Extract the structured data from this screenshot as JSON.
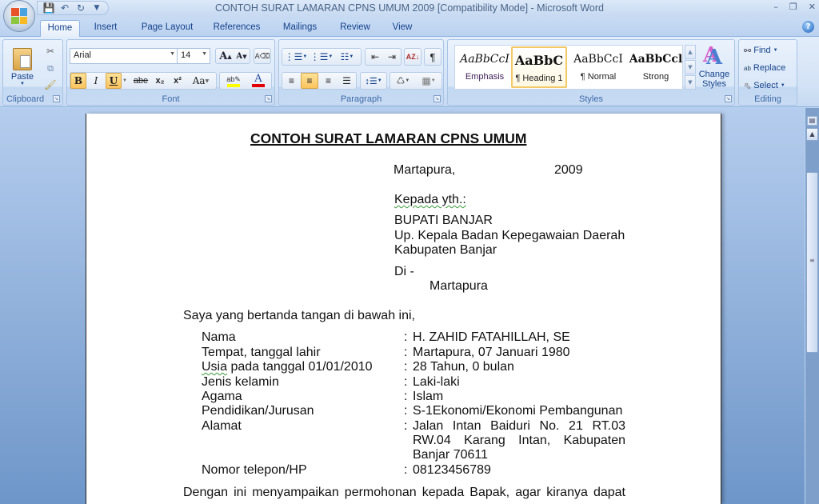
{
  "window": {
    "title": "CONTOH SURAT LAMARAN CPNS UMUM 2009 [Compatibility Mode] - Microsoft Word",
    "controls": [
      "minimize",
      "restore",
      "close"
    ]
  },
  "quick_access": [
    "save-icon",
    "undo-icon",
    "redo-icon",
    "customize-icon"
  ],
  "tabs": [
    {
      "label": "Home",
      "active": true
    },
    {
      "label": "Insert",
      "active": false
    },
    {
      "label": "Page Layout",
      "active": false
    },
    {
      "label": "References",
      "active": false
    },
    {
      "label": "Mailings",
      "active": false
    },
    {
      "label": "Review",
      "active": false
    },
    {
      "label": "View",
      "active": false
    }
  ],
  "ribbon": {
    "clipboard": {
      "label": "Clipboard",
      "paste": "Paste"
    },
    "font": {
      "label": "Font",
      "font_name": "Arial",
      "font_size": "14",
      "bold": "B",
      "italic": "I",
      "underline": "U",
      "strikethrough": "abe",
      "subscript": "x₂",
      "superscript": "x²",
      "change_case": "Aa",
      "grow": "A",
      "shrink": "A",
      "bold_active": true,
      "underline_active": true,
      "highlight_color": "#ffff00",
      "font_color": "#e00000"
    },
    "paragraph": {
      "label": "Paragraph",
      "align_center_active": true
    },
    "styles": {
      "label": "Styles",
      "items": [
        {
          "preview": "AaBbCcI",
          "name": "Emphasis",
          "selected": false
        },
        {
          "preview": "AaBbC",
          "name": "¶ Heading 1",
          "selected": true
        },
        {
          "preview": "AaBbCcI",
          "name": "¶ Normal",
          "selected": false
        },
        {
          "preview": "AaBbCcl",
          "name": "Strong",
          "selected": false
        }
      ],
      "change_styles": "Change Styles"
    },
    "editing": {
      "label": "Editing",
      "find": "Find",
      "replace": "Replace",
      "select": "Select"
    }
  },
  "document": {
    "title": "CONTOH SURAT LAMARAN CPNS UMUM",
    "place": "Martapura,",
    "year": "2009",
    "kepada": "Kepada yth.:",
    "recipient": [
      "BUPATI BANJAR",
      "Up. Kepala Badan Kepegawaian Daerah",
      "Kabupaten Banjar"
    ],
    "di": "Di -",
    "di_city": "Martapura",
    "intro": "Saya yang bertanda tangan di bawah ini,",
    "fields": [
      {
        "label": "Nama",
        "value": "H. ZAHID FATAHILLAH, SE"
      },
      {
        "label": "Tempat, tanggal lahir",
        "value": "Martapura, 07 Januari 1980"
      },
      {
        "label": "Usia pada tanggal 01/01/2010",
        "value": "28 Tahun, 0 bulan"
      },
      {
        "label": "Jenis kelamin",
        "value": "Laki-laki"
      },
      {
        "label": "Agama",
        "value": "Islam"
      },
      {
        "label": "Pendidikan/Jurusan",
        "value": "S-1Ekonomi/Ekonomi Pembangunan"
      },
      {
        "label": "Alamat",
        "value": "Jalan Intan Baiduri No. 21 RT.03 RW.04 Karang Intan, Kabupaten Banjar 70611"
      },
      {
        "label": "Nomor telepon/HP",
        "value": "08123456789"
      }
    ],
    "closing": "Dengan ini menyampaikan permohonan kepada Bapak, agar kiranya dapat"
  }
}
